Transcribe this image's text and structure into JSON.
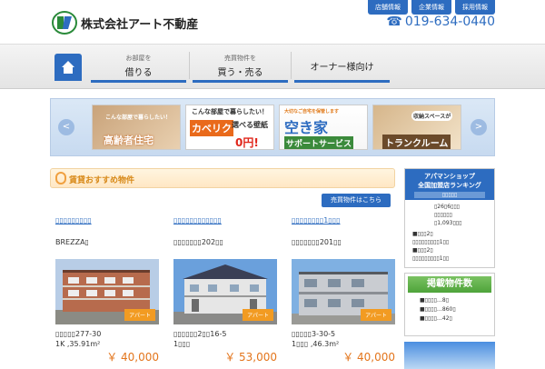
{
  "header": {
    "company": "株式会社アート不動産",
    "links": [
      "店舗情報",
      "企業情報",
      "採用情報"
    ],
    "phone": "019-634-0440"
  },
  "nav": {
    "items": [
      {
        "sub": "お部屋を",
        "main": "借りる"
      },
      {
        "sub": "売買物件を",
        "main": "買う・売る"
      },
      {
        "main": "オーナー様向け"
      }
    ]
  },
  "banners": {
    "b1": {
      "l1": "こんな部屋で暮らしたい！",
      "l2": "高齢者住宅"
    },
    "b2": {
      "l1": "こんな部屋で暮らしたい！",
      "brand": "カベリク",
      "l2": "選べる壁紙",
      "l3": "0円!"
    },
    "b3": {
      "l1": "大切なご自宅を保管します",
      "l2": "空き家",
      "l3": "サポートサービス"
    },
    "b4": {
      "l1": "収納スペースが",
      "l2": "トランクルーム"
    }
  },
  "section": {
    "title": "賃貸おすすめ物件",
    "sale_button": "売買物件はこちら"
  },
  "cards": [
    {
      "link": "▯▯▯▯▯▯▯▯▯",
      "name": "BREZZA▯",
      "tag": "アパート",
      "addr": "▯▯▯▯▯277-30",
      "spec": "1K ,35.91m²",
      "price": "￥ 40,000"
    },
    {
      "link": "▯▯▯▯▯▯▯▯▯▯▯▯",
      "name": "▯▯▯▯▯▯▯202▯▯",
      "tag": "アパート",
      "addr": "▯▯▯▯▯▯2▯▯16-5",
      "spec": "1▯▯▯",
      "price": "￥ 53,000"
    },
    {
      "link": "▯▯▯▯▯▯▯▯1▯▯▯",
      "name": "▯▯▯▯▯▯▯201▯▯",
      "tag": "アパート",
      "addr": "▯▯▯▯▯3-30-5",
      "spec": "1▯▯▯ ,46.3m²",
      "price": "￥ 40,000"
    }
  ],
  "sidebar": {
    "title": "アパマンショップ",
    "subtitle": "全国加盟店ランキング",
    "tag": "▯▯▯▯▯",
    "lines": [
      "▯26▯6▯▯▯",
      "▯▯▯▯▯▯",
      "▯1,093▯▯▯"
    ],
    "list": [
      "■▯▯▯2▯",
      "▯▯▯▯▯▯▯▯▯1▯▯",
      "■▯▯▯2▯",
      "▯▯▯▯▯▯▯▯▯1▯▯"
    ]
  },
  "counts": {
    "title": "掲載物件数",
    "list": [
      "■▯▯▯▯…8▯",
      "■▯▯▯▯…860▯",
      "■▯▯▯▯…42▯"
    ]
  },
  "colors": {
    "accent": "#2d6cc0",
    "orange": "#f29b22",
    "price": "#e3751c",
    "green": "#4ea33a"
  }
}
